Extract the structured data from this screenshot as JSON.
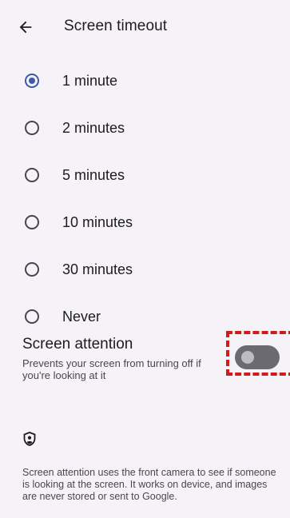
{
  "header": {
    "title": "Screen timeout"
  },
  "options": [
    {
      "label": "1 minute",
      "selected": true
    },
    {
      "label": "2 minutes",
      "selected": false
    },
    {
      "label": "5 minutes",
      "selected": false
    },
    {
      "label": "10 minutes",
      "selected": false
    },
    {
      "label": "30 minutes",
      "selected": false
    },
    {
      "label": "Never",
      "selected": false
    }
  ],
  "screen_attention": {
    "title": "Screen attention",
    "summary": "Prevents your screen from turning off if you're looking at it",
    "enabled": false
  },
  "footer": {
    "text": "Screen attention uses the front camera to see if someone is looking at the screen. It works on device, and images are never stored or sent to Google."
  },
  "colors": {
    "accent": "#3b5ba9",
    "background": "#f6f3f8",
    "highlight": "#d11a1a"
  },
  "icons": {
    "back": "arrow-left-icon",
    "privacy": "shield-person-icon"
  }
}
